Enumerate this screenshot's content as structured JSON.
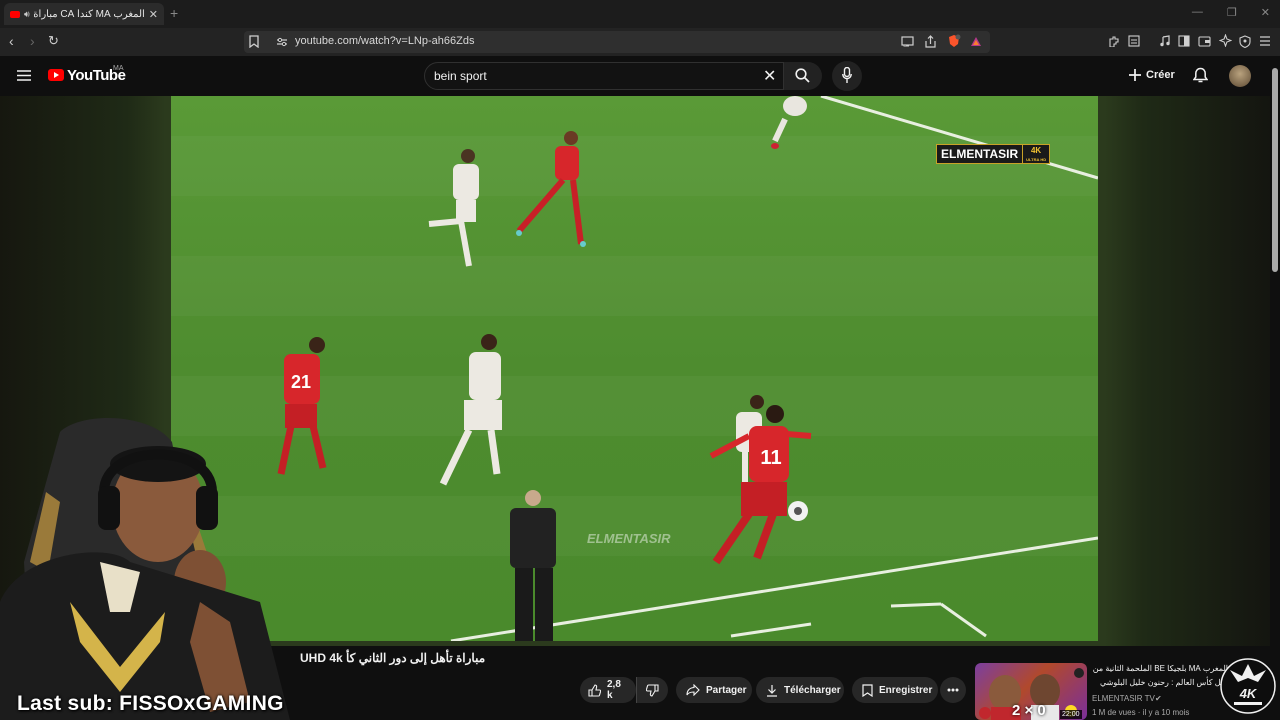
{
  "browser": {
    "tab_title": "المغرب MA كندا CA مباراة تأهل",
    "url": "youtube.com/watch?v=LNp-ah66Zds"
  },
  "youtube": {
    "logo_text": "YouTube",
    "country_code": "MA",
    "search_value": "bein sport",
    "create_label": "Créer"
  },
  "video": {
    "watermark_top": "ELMENTASIR",
    "watermark_4k": "4K",
    "watermark_4k_sub": "ULTRA HD",
    "watermark_center": "ELMENTASIR",
    "title": "مباراة تأهل إلى دور الثاني كأ UHD 4k",
    "likes": "2,8 k",
    "share_label": "Partager",
    "download_label": "Télécharger",
    "save_label": "Enregistrer"
  },
  "overlay": {
    "last_sub": "Last sub: FISSOxGAMING"
  },
  "recommended": {
    "title": "المغرب MA بلجيكا BE الملحمة الثانية من أجل كأس العالم : رحنون خليل البلوشي جودة",
    "channel": "ELMENTASIR TV",
    "meta": "1 M de vues · il y a 10 mois",
    "score": "2 × 0",
    "duration": "22:00"
  },
  "colors": {
    "yt_red": "#ff0000",
    "pitch_green": "#4e8c2f",
    "background": "#0f0f0f"
  }
}
